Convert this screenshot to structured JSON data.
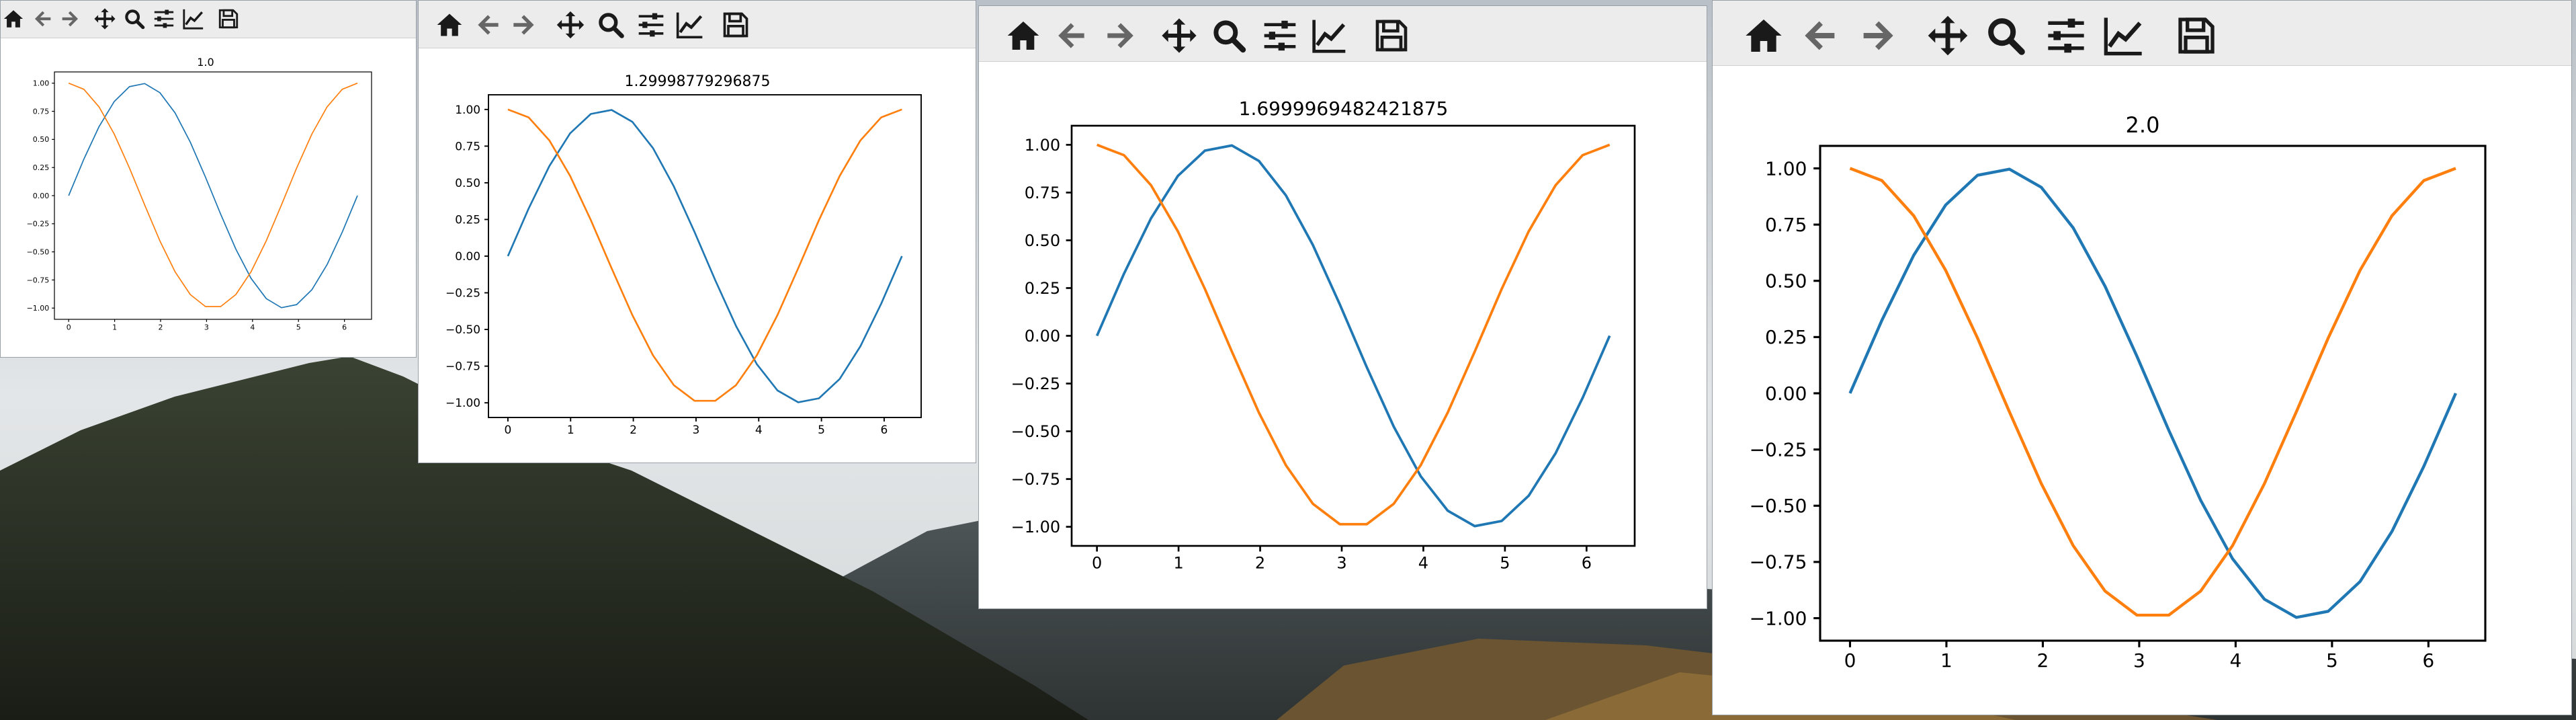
{
  "toolbar": {
    "icons": [
      "home-icon",
      "back-arrow-icon",
      "forward-arrow-icon",
      "pan-move-icon",
      "zoom-magnifier-icon",
      "subplots-configure-icon",
      "edit-axes-icon",
      "save-floppy-icon"
    ]
  },
  "windows": [
    {
      "title": "1.0"
    },
    {
      "title": "1.29998779296875"
    },
    {
      "title": "1.6999969482421875"
    },
    {
      "title": "2.0"
    }
  ],
  "colors": {
    "sine_series": "#1f77b4",
    "cosine_series": "#ff7f0e",
    "toolbar_icon": "#1a1a1a",
    "toolbar_disabled": "#666666"
  },
  "chart_data": [
    {
      "type": "line",
      "title": "1.0",
      "xlim": [
        -0.31,
        6.59
      ],
      "ylim": [
        -1.1,
        1.1
      ],
      "xticks": [
        0,
        1,
        2,
        3,
        4,
        5,
        6
      ],
      "yticks": [
        -1.0,
        -0.75,
        -0.5,
        -0.25,
        0.0,
        0.25,
        0.5,
        0.75,
        1.0
      ],
      "ytick_labels": [
        "−1.00",
        "−0.75",
        "−0.50",
        "−0.25",
        "0.00",
        "0.25",
        "0.50",
        "0.75",
        "1.00"
      ],
      "x": [
        0,
        0.3307,
        0.6614,
        0.9921,
        1.3228,
        1.6535,
        1.9842,
        2.3149,
        2.6456,
        2.9762,
        3.3069,
        3.6376,
        3.9683,
        4.299,
        4.6297,
        4.9604,
        5.2911,
        5.6218,
        5.9525,
        6.2832
      ],
      "series": [
        {
          "values": [
            0,
            0.3247,
            0.6142,
            0.8372,
            0.9694,
            0.9966,
            0.9158,
            0.7357,
            0.4759,
            0.1646,
            -0.1646,
            -0.4759,
            -0.7357,
            -0.9158,
            -0.9966,
            -0.9694,
            -0.8372,
            -0.6142,
            -0.3247,
            0
          ]
        },
        {
          "values": [
            1,
            0.9458,
            0.7891,
            0.5469,
            0.2455,
            -0.0826,
            -0.4017,
            -0.6773,
            -0.8795,
            -0.9864,
            -0.9864,
            -0.8795,
            -0.6773,
            -0.4017,
            -0.0826,
            0.2455,
            0.5469,
            0.7891,
            0.9458,
            1
          ]
        }
      ]
    },
    {
      "type": "line",
      "title": "1.29998779296875",
      "xlim": [
        -0.31,
        6.59
      ],
      "ylim": [
        -1.1,
        1.1
      ],
      "xticks": [
        0,
        1,
        2,
        3,
        4,
        5,
        6
      ],
      "yticks": [
        -1.0,
        -0.75,
        -0.5,
        -0.25,
        0.0,
        0.25,
        0.5,
        0.75,
        1.0
      ],
      "ytick_labels": [
        "−1.00",
        "−0.75",
        "−0.50",
        "−0.25",
        "0.00",
        "0.25",
        "0.50",
        "0.75",
        "1.00"
      ],
      "x": [
        0,
        0.3307,
        0.6614,
        0.9921,
        1.3228,
        1.6535,
        1.9842,
        2.3149,
        2.6456,
        2.9762,
        3.3069,
        3.6376,
        3.9683,
        4.299,
        4.6297,
        4.9604,
        5.2911,
        5.6218,
        5.9525,
        6.2832
      ],
      "series": [
        {
          "values": [
            0,
            0.3247,
            0.6142,
            0.8372,
            0.9694,
            0.9966,
            0.9158,
            0.7357,
            0.4759,
            0.1646,
            -0.1646,
            -0.4759,
            -0.7357,
            -0.9158,
            -0.9966,
            -0.9694,
            -0.8372,
            -0.6142,
            -0.3247,
            0
          ]
        },
        {
          "values": [
            1,
            0.9458,
            0.7891,
            0.5469,
            0.2455,
            -0.0826,
            -0.4017,
            -0.6773,
            -0.8795,
            -0.9864,
            -0.9864,
            -0.8795,
            -0.6773,
            -0.4017,
            -0.0826,
            0.2455,
            0.5469,
            0.7891,
            0.9458,
            1
          ]
        }
      ]
    },
    {
      "type": "line",
      "title": "1.6999969482421875",
      "xlim": [
        -0.31,
        6.59
      ],
      "ylim": [
        -1.1,
        1.1
      ],
      "xticks": [
        0,
        1,
        2,
        3,
        4,
        5,
        6
      ],
      "yticks": [
        -1.0,
        -0.75,
        -0.5,
        -0.25,
        0.0,
        0.25,
        0.5,
        0.75,
        1.0
      ],
      "ytick_labels": [
        "−1.00",
        "−0.75",
        "−0.50",
        "−0.25",
        "0.00",
        "0.25",
        "0.50",
        "0.75",
        "1.00"
      ],
      "x": [
        0,
        0.3307,
        0.6614,
        0.9921,
        1.3228,
        1.6535,
        1.9842,
        2.3149,
        2.6456,
        2.9762,
        3.3069,
        3.6376,
        3.9683,
        4.299,
        4.6297,
        4.9604,
        5.2911,
        5.6218,
        5.9525,
        6.2832
      ],
      "series": [
        {
          "values": [
            0,
            0.3247,
            0.6142,
            0.8372,
            0.9694,
            0.9966,
            0.9158,
            0.7357,
            0.4759,
            0.1646,
            -0.1646,
            -0.4759,
            -0.7357,
            -0.9158,
            -0.9966,
            -0.9694,
            -0.8372,
            -0.6142,
            -0.3247,
            0
          ]
        },
        {
          "values": [
            1,
            0.9458,
            0.7891,
            0.5469,
            0.2455,
            -0.0826,
            -0.4017,
            -0.6773,
            -0.8795,
            -0.9864,
            -0.9864,
            -0.8795,
            -0.6773,
            -0.4017,
            -0.0826,
            0.2455,
            0.5469,
            0.7891,
            0.9458,
            1
          ]
        }
      ]
    },
    {
      "type": "line",
      "title": "2.0",
      "xlim": [
        -0.31,
        6.59
      ],
      "ylim": [
        -1.1,
        1.1
      ],
      "xticks": [
        0,
        1,
        2,
        3,
        4,
        5,
        6
      ],
      "yticks": [
        -1.0,
        -0.75,
        -0.5,
        -0.25,
        0.0,
        0.25,
        0.5,
        0.75,
        1.0
      ],
      "ytick_labels": [
        "−1.00",
        "−0.75",
        "−0.50",
        "−0.25",
        "0.00",
        "0.25",
        "0.50",
        "0.75",
        "1.00"
      ],
      "x": [
        0,
        0.3307,
        0.6614,
        0.9921,
        1.3228,
        1.6535,
        1.9842,
        2.3149,
        2.6456,
        2.9762,
        3.3069,
        3.6376,
        3.9683,
        4.299,
        4.6297,
        4.9604,
        5.2911,
        5.6218,
        5.9525,
        6.2832
      ],
      "series": [
        {
          "values": [
            0,
            0.3247,
            0.6142,
            0.8372,
            0.9694,
            0.9966,
            0.9158,
            0.7357,
            0.4759,
            0.1646,
            -0.1646,
            -0.4759,
            -0.7357,
            -0.9158,
            -0.9966,
            -0.9694,
            -0.8372,
            -0.6142,
            -0.3247,
            0
          ]
        },
        {
          "values": [
            1,
            0.9458,
            0.7891,
            0.5469,
            0.2455,
            -0.0826,
            -0.4017,
            -0.6773,
            -0.8795,
            -0.9864,
            -0.9864,
            -0.8795,
            -0.6773,
            -0.4017,
            -0.0826,
            0.2455,
            0.5469,
            0.7891,
            0.9458,
            1
          ]
        }
      ]
    }
  ]
}
